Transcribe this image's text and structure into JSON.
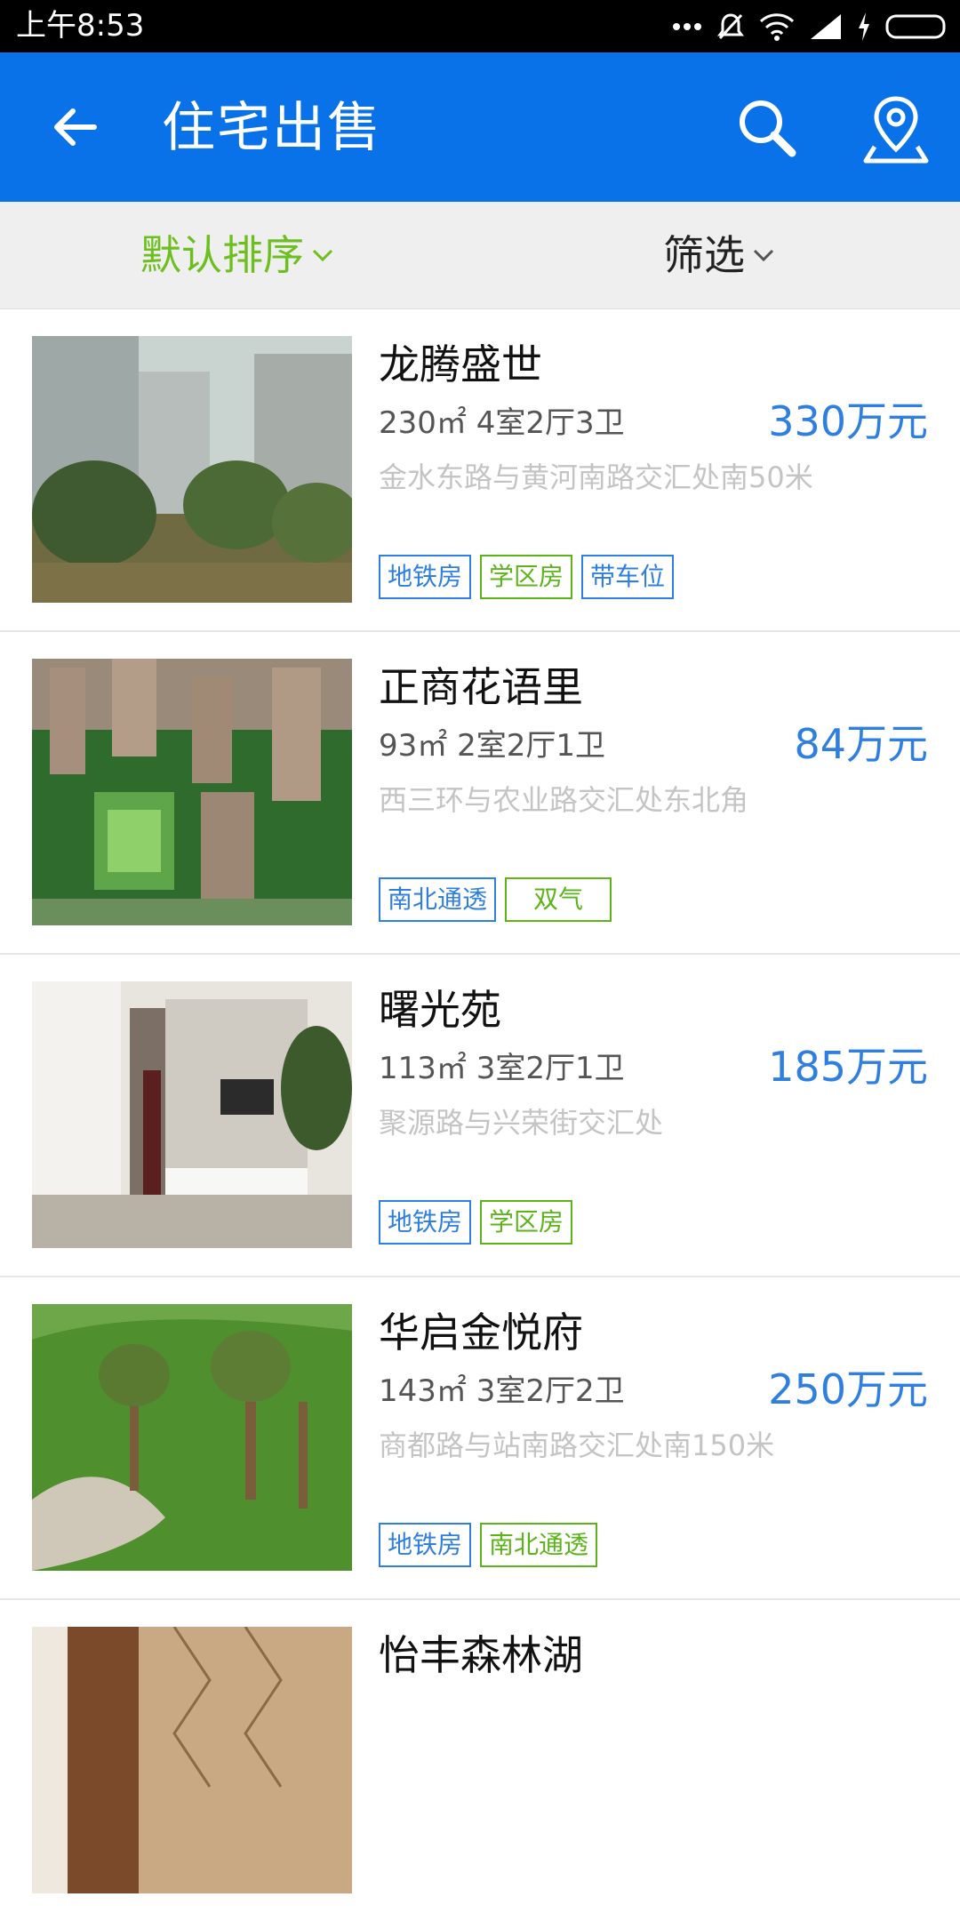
{
  "status": {
    "time": "上午8:53"
  },
  "appbar": {
    "title": "住宅出售"
  },
  "filters": {
    "sort_label": "默认排序",
    "filter_label": "筛选"
  },
  "colors": {
    "primary": "#0a72e8",
    "price": "#2f7fe0",
    "sort_active": "#6cbf1f",
    "tag_blue": "#2f7fe0",
    "tag_green": "#5cb31a",
    "address": "#c4c4c4"
  },
  "listings": [
    {
      "name": "龙腾盛世",
      "spec": "230㎡ 4室2厅3卫",
      "price": "330万元",
      "address": "金水东路与黄河南路交汇处南50米",
      "tags": [
        {
          "label": "地铁房",
          "color": "blue"
        },
        {
          "label": "学区房",
          "color": "green"
        },
        {
          "label": "带车位",
          "color": "blue"
        }
      ]
    },
    {
      "name": "正商花语里",
      "spec": "93㎡ 2室2厅1卫",
      "price": "84万元",
      "address": "西三环与农业路交汇处东北角",
      "tags": [
        {
          "label": "南北通透",
          "color": "blue"
        },
        {
          "label": "双气",
          "color": "green"
        }
      ]
    },
    {
      "name": "曙光苑",
      "spec": "113㎡ 3室2厅1卫",
      "price": "185万元",
      "address": "聚源路与兴荣街交汇处",
      "tags": [
        {
          "label": "地铁房",
          "color": "blue"
        },
        {
          "label": "学区房",
          "color": "green"
        }
      ]
    },
    {
      "name": "华启金悦府",
      "spec": "143㎡ 3室2厅2卫",
      "price": "250万元",
      "address": "商都路与站南路交汇处南150米",
      "tags": [
        {
          "label": "地铁房",
          "color": "blue"
        },
        {
          "label": "南北通透",
          "color": "green"
        }
      ]
    },
    {
      "name": "怡丰森林湖",
      "spec": "",
      "price": "",
      "address": "",
      "tags": []
    }
  ]
}
